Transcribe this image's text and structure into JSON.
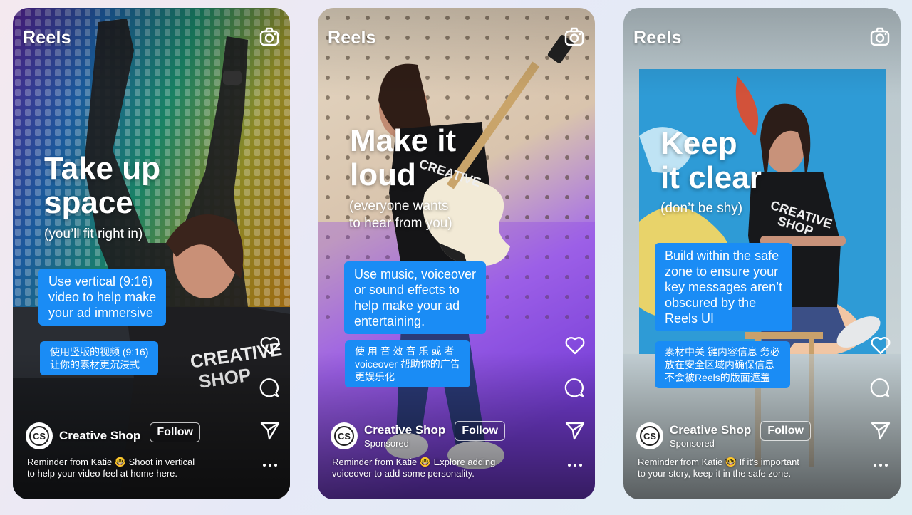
{
  "cards": [
    {
      "reels": "Reels",
      "headline": "Take up\nspace",
      "subline": "(you’ll fit right in)",
      "bubble_en": "Use vertical (9:16)\nvideo to help make\nyour ad immersive",
      "bubble_zh": "使用竖版的视频 (9:16)\n让你的素材更沉浸式",
      "shop": "Creative Shop",
      "sponsored": "",
      "follow": "Follow",
      "caption": "Reminder from Katie 🤓  Shoot in vertical\nto help your video feel at home here."
    },
    {
      "reels": "Reels",
      "headline": "Make it\nloud",
      "subline": "(everyone wants\nto hear from you)",
      "bubble_en": "Use music, voiceover\nor sound effects to\nhelp make your ad\nentertaining.",
      "bubble_zh": "使 用 音 效 音 乐 或 者\nvoiceover   帮助你的广告\n更娱乐化",
      "shop": "Creative Shop",
      "sponsored": "Sponsored",
      "follow": "Follow",
      "caption": "Reminder from Katie 🤓  Explore adding\nvoiceover to add some personality."
    },
    {
      "reels": "Reels",
      "headline": "Keep\nit clear",
      "subline": "(don’t be shy)",
      "bubble_en": "Build within the safe\nzone to ensure your\nkey messages aren’t\nobscured by the\nReels UI",
      "bubble_zh": "素材中关 键内容信息 务必\n放在安全区域内确保信息\n不会被Reels的版面遮盖",
      "shop": "Creative Shop",
      "sponsored": "Sponsored",
      "follow": "Follow",
      "caption": "Reminder from Katie 🤓  If it’s important\nto your story, keep it in the safe zone."
    }
  ],
  "avatar_initials": "CS",
  "icons": [
    "camera-icon",
    "heart-icon",
    "comment-icon",
    "share-icon",
    "more-icon"
  ],
  "colors": {
    "bubble": "#1a8cf5"
  }
}
